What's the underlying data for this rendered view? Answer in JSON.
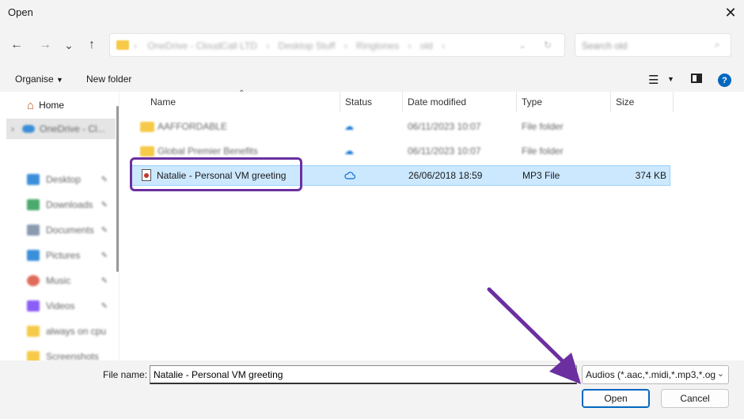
{
  "window": {
    "title": "Open",
    "close_icon": "close-icon"
  },
  "nav": {
    "back_icon": "←",
    "forward_icon": "→",
    "recent_icon": "⌄",
    "up_icon": "↑",
    "breadcrumb": [
      "OneDrive - CloudCall LTD",
      "Desktop Stuff",
      "Ringtones",
      "old"
    ],
    "search_placeholder": "Search old"
  },
  "toolbar": {
    "organise": "Organise",
    "new_folder": "New folder",
    "help": "?"
  },
  "sidebar": {
    "home": "Home",
    "onedrive": "OneDrive - Cl...",
    "items": [
      "Desktop",
      "Downloads",
      "Documents",
      "Pictures",
      "Music",
      "Videos",
      "always on cpu",
      "Screenshots"
    ],
    "item_colors": [
      "#3b8fd9",
      "#4aa96c",
      "#8a9bb0",
      "#3b8fd9",
      "#e06b5a",
      "#8b5cf6",
      "#f7c948",
      "#f7c948"
    ]
  },
  "columns": [
    "Name",
    "Status",
    "Date modified",
    "Type",
    "Size"
  ],
  "files": [
    {
      "name": "AAFFORDABLE",
      "status": "cloud",
      "date": "06/11/2023 10:07",
      "type": "File folder",
      "size": "",
      "kind": "folder"
    },
    {
      "name": "Global Premier Benefits",
      "status": "cloud",
      "date": "06/11/2023 10:07",
      "type": "File folder",
      "size": "",
      "kind": "folder"
    },
    {
      "name": "Natalie - Personal VM greeting",
      "status": "cloud",
      "date": "26/06/2018 18:59",
      "type": "MP3 File",
      "size": "374 KB",
      "kind": "mp3"
    }
  ],
  "bottom": {
    "file_name_label": "File name:",
    "file_name_value": "Natalie - Personal VM greeting",
    "filter": "Audios (*.aac,*.midi,*.mp3,*.og",
    "open": "Open",
    "cancel": "Cancel"
  },
  "colors": {
    "selection": "#cce8ff",
    "selection_border": "#99d1ff",
    "annotation": "#6b2fa0",
    "accent": "#0067c0"
  }
}
